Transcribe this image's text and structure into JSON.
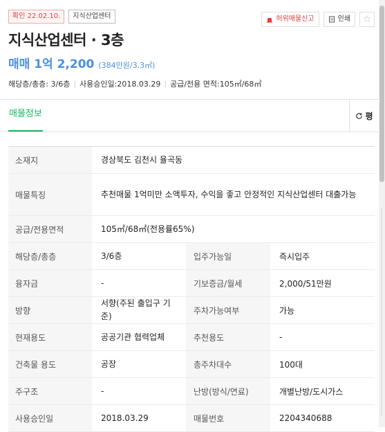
{
  "badges": {
    "confirm": "확인 22.02.10.",
    "category": "지식산업센터"
  },
  "actions": {
    "report": "허위매물신고",
    "print": "인쇄"
  },
  "title": "지식산업센터 · 3층",
  "price": {
    "main": "매매 1억 2,200",
    "per_area": "(384만원/3.3㎡)"
  },
  "summary": {
    "floor": "해당층/총층: 3/6층",
    "approval": "사용승인일:2018.03.29",
    "area": "공급/전용 면적:105㎡/68㎡"
  },
  "tab": "매물정보",
  "unit_toggle": "평",
  "details": {
    "location_label": "소재지",
    "location_value": "경상북도 김천시 율곡동",
    "feature_label": "매물특징",
    "feature_value": "추천매물 1억미만 소액투자, 수익을 좋고 안정적인 지식산업센터 대출가능",
    "area_label": "공급/전용면적",
    "area_value": "105㎡/68㎡(전용률65%)",
    "floor_label": "해당층/총층",
    "floor_value": "3/6층",
    "movein_label": "입주가능일",
    "movein_value": "즉시입주",
    "loan_label": "융자금",
    "loan_value": "-",
    "deposit_label": "기보증금/월세",
    "deposit_value": "2,000/51만원",
    "direction_label": "방향",
    "direction_value": "서향(주된 출입구 기준)",
    "parking_label": "주차가능여부",
    "parking_value": "가능",
    "use_label": "현재용도",
    "use_value": "공공기관 협력업체",
    "recommend_label": "추천용도",
    "recommend_value": "-",
    "building_use_label": "건축물 용도",
    "building_use_value": "공장",
    "total_parking_label": "총주차대수",
    "total_parking_value": "100대",
    "structure_label": "주구조",
    "structure_value": "-",
    "heating_label": "난방(방식/연료)",
    "heating_value": "개별난방/도시가스",
    "approval_label": "사용승인일",
    "approval_value": "2018.03.29",
    "listing_no_label": "매물번호",
    "listing_no_value": "2204340688"
  }
}
